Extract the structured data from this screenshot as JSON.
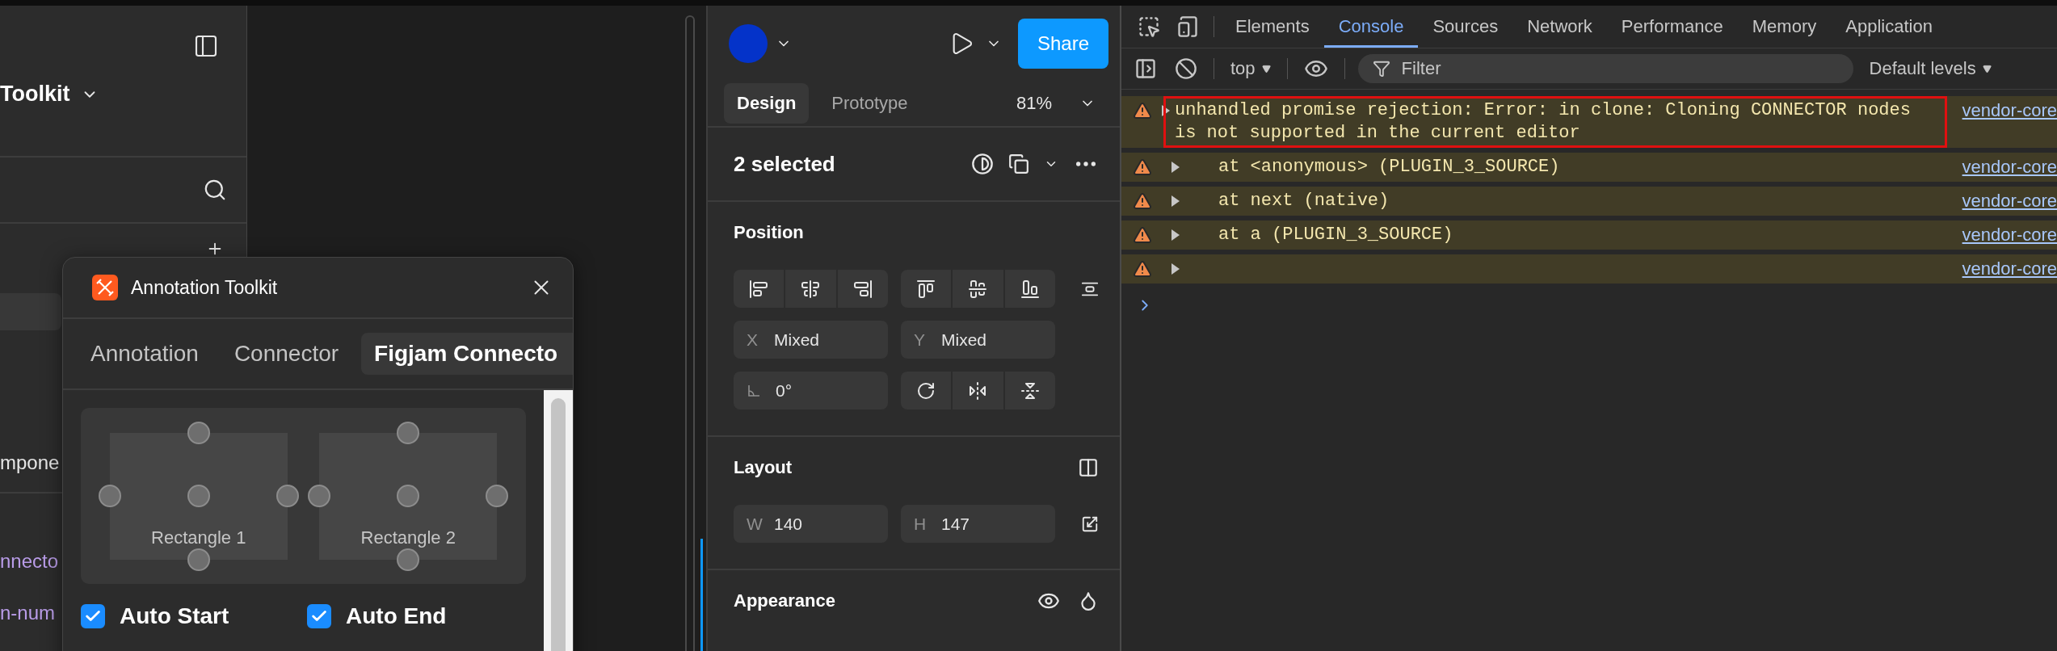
{
  "sidebar": {
    "title": "Toolkit",
    "items": [
      {
        "text": "mpone",
        "kind": "layer"
      },
      {
        "text": "nnecto",
        "kind": "code"
      },
      {
        "text": "n-num",
        "kind": "code"
      }
    ]
  },
  "plugin": {
    "title": "Annotation Toolkit",
    "tabs": [
      {
        "label": "Annotation",
        "selected": false
      },
      {
        "label": "Connector",
        "selected": false
      },
      {
        "label": "Figjam Connecto",
        "selected": true
      }
    ],
    "shapes": [
      {
        "label": "Rectangle 1"
      },
      {
        "label": "Rectangle 2"
      }
    ],
    "options": [
      {
        "label": "Auto Start",
        "checked": true
      },
      {
        "label": "Auto End",
        "checked": true
      }
    ]
  },
  "properties": {
    "share": "Share",
    "tabs": [
      {
        "label": "Design",
        "selected": true
      },
      {
        "label": "Prototype",
        "selected": false
      }
    ],
    "zoom": "81%",
    "selection": "2 selected",
    "position": {
      "title": "Position",
      "fields": [
        {
          "label": "X",
          "value": "Mixed"
        },
        {
          "label": "Y",
          "value": "Mixed"
        }
      ],
      "rotation": "0°"
    },
    "layout": {
      "title": "Layout",
      "fields": [
        {
          "label": "W",
          "value": "140"
        },
        {
          "label": "H",
          "value": "147"
        }
      ]
    },
    "appearance": {
      "title": "Appearance"
    }
  },
  "devtools": {
    "tabs": [
      {
        "label": "Elements",
        "selected": false
      },
      {
        "label": "Console",
        "selected": true
      },
      {
        "label": "Sources",
        "selected": false
      },
      {
        "label": "Network",
        "selected": false
      },
      {
        "label": "Performance",
        "selected": false
      },
      {
        "label": "Memory",
        "selected": false
      },
      {
        "label": "Application",
        "selected": false
      }
    ],
    "context": "top",
    "filter_placeholder": "Filter",
    "levels": "Default levels",
    "messages": [
      {
        "kind": "head",
        "text": "unhandled promise rejection: Error: in clone: Cloning CONNECTOR nodes is not supported in the current editor",
        "highlighted": true,
        "source": "vendor-core"
      },
      {
        "kind": "stack",
        "text": "at <anonymous> (PLUGIN_3_SOURCE)",
        "highlighted": false,
        "source": "vendor-core"
      },
      {
        "kind": "stack",
        "text": "at next (native)",
        "highlighted": false,
        "source": "vendor-core"
      },
      {
        "kind": "stack",
        "text": "at a (PLUGIN_3_SOURCE)",
        "highlighted": false,
        "source": "vendor-core"
      },
      {
        "kind": "stack",
        "highlighted": false,
        "source": "vendor-core"
      }
    ]
  }
}
